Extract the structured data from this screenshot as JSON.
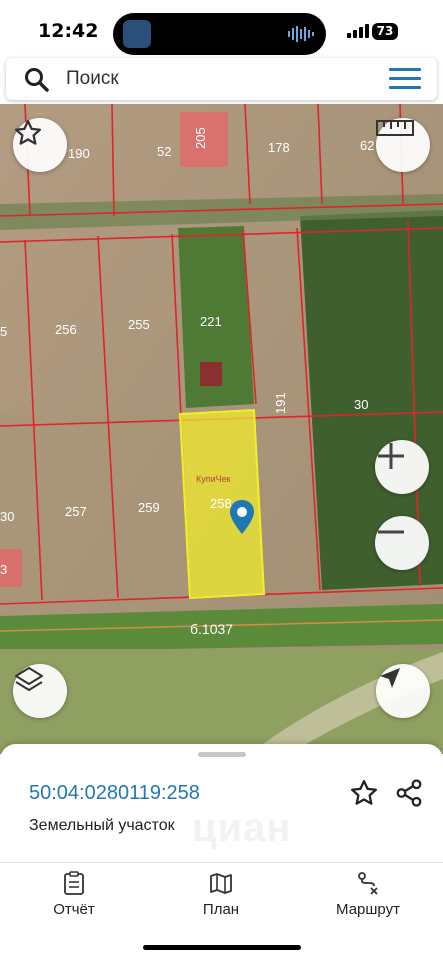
{
  "status_bar": {
    "time": "12:42",
    "battery": "73"
  },
  "search": {
    "placeholder": "Поиск"
  },
  "map": {
    "plot_labels": [
      "190",
      "52",
      "205",
      "178",
      "62",
      "256",
      "255",
      "221",
      "5",
      "191",
      "30",
      "30",
      "257",
      "259",
      "258",
      "3"
    ],
    "selected_plot": "258",
    "road_label": "б.1037",
    "building_label": "КупиЧек",
    "selection_color": "#f3ee2a",
    "boundary_color": "#e0242b"
  },
  "parcel": {
    "cadastral_number": "50:04:0280119:258",
    "type": "Земельный участок",
    "watermark": "циан"
  },
  "tabs": [
    {
      "label": "Отчёт",
      "icon": "report-icon"
    },
    {
      "label": "План",
      "icon": "map-plan-icon"
    },
    {
      "label": "Маршрут",
      "icon": "route-icon"
    }
  ],
  "colors": {
    "accent": "#1f78b4"
  }
}
